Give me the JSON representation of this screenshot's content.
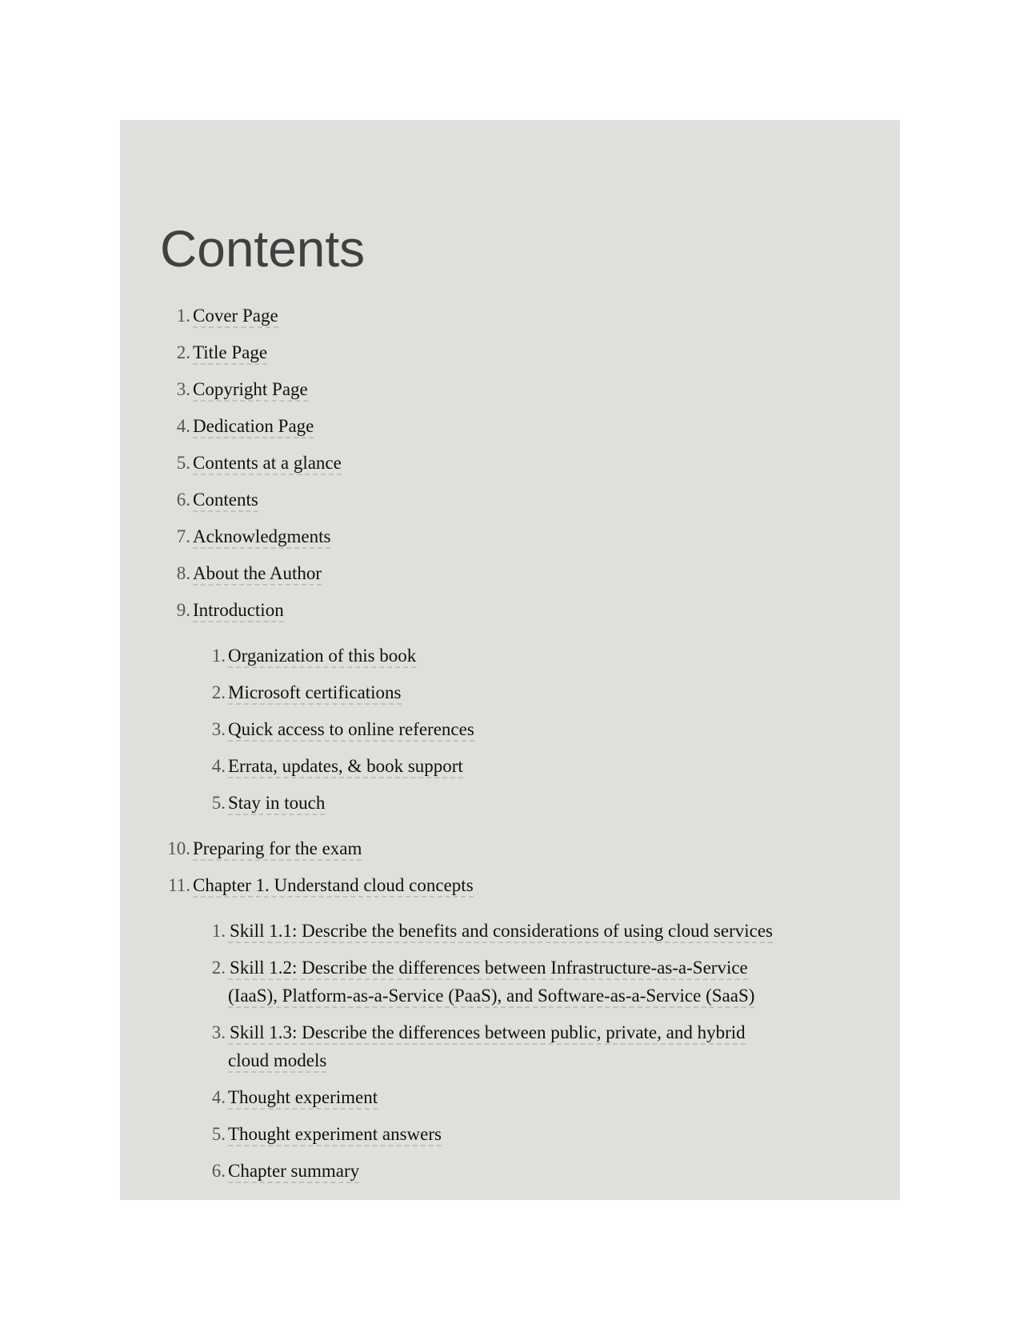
{
  "page": {
    "title": "Contents",
    "background_color": "#e0dfdb"
  },
  "toc": [
    {
      "number": "1.",
      "label": "Cover Page"
    },
    {
      "number": "2.",
      "label": "Title Page"
    },
    {
      "number": "3.",
      "label": "Copyright Page"
    },
    {
      "number": "4.",
      "label": "Dedication Page"
    },
    {
      "number": "5.",
      "label": "Contents at a glance"
    },
    {
      "number": "6.",
      "label": "Contents"
    },
    {
      "number": "7.",
      "label": "Acknowledgments"
    },
    {
      "number": "8.",
      "label": "About the Author"
    },
    {
      "number": "9.",
      "label": "Introduction",
      "children": [
        {
          "number": "1.",
          "label": "Organization of this book"
        },
        {
          "number": "2.",
          "label": "Microsoft certifications"
        },
        {
          "number": "3.",
          "label": "Quick access to online references"
        },
        {
          "number": "4.",
          "label": "Errata, updates, & book support"
        },
        {
          "number": "5.",
          "label": "Stay in touch"
        }
      ]
    },
    {
      "number": "10.",
      "label": "Preparing for the exam"
    },
    {
      "number": "11.",
      "label": "Chapter 1. Understand cloud concepts",
      "children": [
        {
          "number": "1.",
          "label": "Skill 1.1: Describe the benefits and considerations of using cloud services"
        },
        {
          "number": "2.",
          "label": "Skill 1.2: Describe the differences between Infrastructure-as-a-Service (IaaS), Platform-as-a-Service (PaaS), and Software-as-a-Service (SaaS)"
        },
        {
          "number": "3.",
          "label": "Skill 1.3: Describe the differences between public, private, and hybrid cloud models"
        },
        {
          "number": "4.",
          "label": "Thought experiment"
        },
        {
          "number": "5.",
          "label": "Thought experiment answers"
        },
        {
          "number": "6.",
          "label": "Chapter summary"
        }
      ]
    }
  ]
}
